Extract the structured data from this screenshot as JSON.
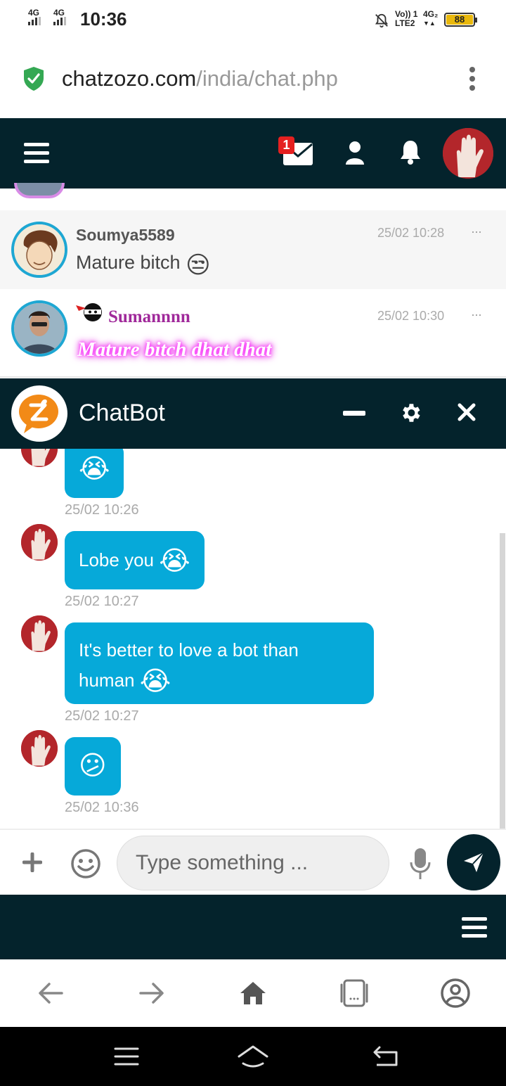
{
  "status_bar": {
    "net1": "4G",
    "net2": "4G",
    "time": "10:36",
    "volte": "Vo)) 1",
    "lte": "LTE2",
    "net3": "4G₂",
    "battery": "88"
  },
  "browser": {
    "url_host": "chatzozo.com",
    "url_path": "/india/chat.php"
  },
  "header": {
    "mail_badge": "1"
  },
  "messages": [
    {
      "user": "Soumya5589",
      "text": "Mature bitch",
      "emoji": "😒",
      "time": "25/02 10:28",
      "more": "···",
      "user_color": "#555555"
    },
    {
      "user": "Sumannnn",
      "text": "Mature bitch dhat dhat",
      "time": "25/02 10:30",
      "more": "···",
      "user_color": "#a0299a"
    }
  ],
  "chatbot": {
    "title": "ChatBot",
    "entries": [
      {
        "text": "",
        "emoji": "😭",
        "time": "25/02 10:26"
      },
      {
        "text": "Lobe you",
        "emoji": "😭",
        "time": "25/02 10:27"
      },
      {
        "text": "It's better to love a bot than",
        "text2": "human",
        "emoji": "😭",
        "time": "25/02 10:27"
      },
      {
        "text": "",
        "emoji": "😕",
        "time": "25/02 10:36"
      }
    ],
    "input_placeholder": "Type something ..."
  },
  "icons": {
    "secure": "shield-check-icon",
    "menu": "hamburger-icon",
    "mail": "envelope-icon",
    "user": "user-icon",
    "bell": "bell-icon",
    "minimize": "minus-icon",
    "settings": "gear-icon",
    "close": "close-icon",
    "add": "plus-icon",
    "emoji": "smiley-icon",
    "mic": "microphone-icon",
    "send": "paper-plane-icon"
  },
  "colors": {
    "dark_header": "#04232c",
    "bubble": "#06a9d9",
    "accent_secure": "#34a853",
    "badge": "#e52020"
  }
}
